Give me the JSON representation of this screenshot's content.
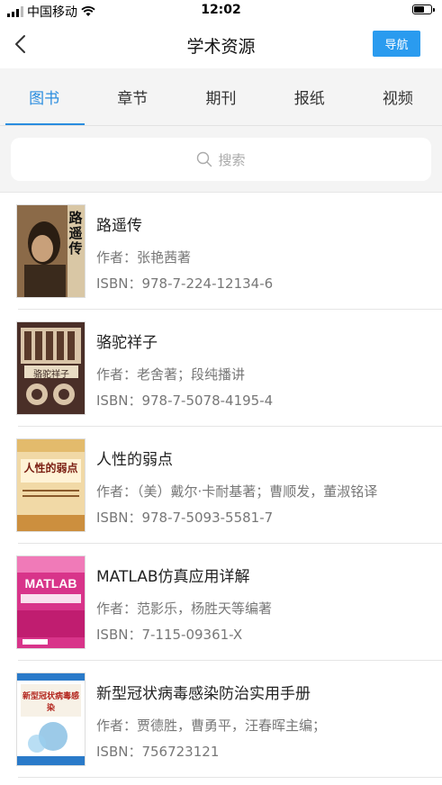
{
  "status_bar": {
    "carrier": "中国移动",
    "time": "12:02"
  },
  "nav": {
    "title": "学术资源",
    "guide_label": "导航"
  },
  "tabs": [
    {
      "label": "图书",
      "active": true
    },
    {
      "label": "章节",
      "active": false
    },
    {
      "label": "期刊",
      "active": false
    },
    {
      "label": "报纸",
      "active": false
    },
    {
      "label": "视频",
      "active": false
    }
  ],
  "search": {
    "placeholder": "搜索"
  },
  "books": [
    {
      "title": "路遥传",
      "author_label": "作者：",
      "author": "张艳茜著",
      "isbn_label": "ISBN：",
      "isbn": "978-7-224-12134-6",
      "cover_text": "路遥传"
    },
    {
      "title": "骆驼祥子",
      "author_label": "作者：",
      "author": "老舍著；段纯播讲",
      "isbn_label": "ISBN：",
      "isbn": "978-7-5078-4195-4",
      "cover_text": "骆驼祥子"
    },
    {
      "title": "人性的弱点",
      "author_label": "作者：",
      "author": "（美）戴尔·卡耐基著；曹顺发，董淑铭译",
      "isbn_label": "ISBN：",
      "isbn": "978-7-5093-5581-7",
      "cover_text": "人性的弱点"
    },
    {
      "title": "MATLAB仿真应用详解",
      "author_label": "作者：",
      "author": "范影乐，杨胜天等编著",
      "isbn_label": "ISBN：",
      "isbn": "7-115-09361-X",
      "cover_text": "MATLAB"
    },
    {
      "title": "新型冠状病毒感染防治实用手册",
      "author_label": "作者：",
      "author": "贾德胜，曹勇平，汪春晖主编；",
      "isbn_label": "ISBN：",
      "isbn": "756723121",
      "cover_text": "新型冠状病毒感染"
    }
  ]
}
